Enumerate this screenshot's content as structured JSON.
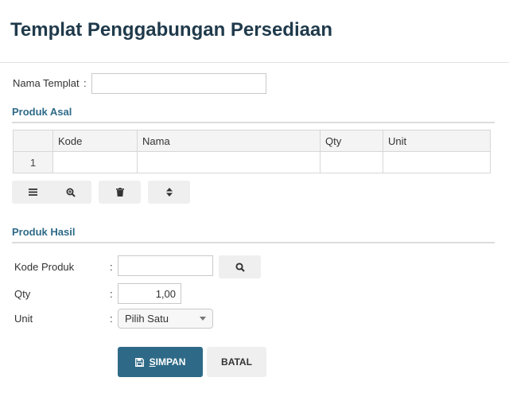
{
  "page": {
    "title": "Templat Penggabungan Persediaan"
  },
  "form": {
    "nama_templat": {
      "label": "Nama Templat",
      "colon": ":",
      "value": "",
      "placeholder": ""
    }
  },
  "produk_asal": {
    "title": "Produk Asal",
    "columns": [
      "",
      "Kode",
      "Nama",
      "Qty",
      "Unit"
    ],
    "rows": [
      {
        "no": "1",
        "kode": "",
        "nama": "",
        "qty": "",
        "unit": ""
      }
    ],
    "toolbar": [
      "list-icon",
      "zoom-icon",
      "trash-icon",
      "sort-icon"
    ]
  },
  "produk_hasil": {
    "title": "Produk Hasil",
    "kode_produk": {
      "label": "Kode Produk",
      "colon": ":",
      "value": ""
    },
    "qty": {
      "label": "Qty",
      "colon": ":",
      "value": "1,00"
    },
    "unit": {
      "label": "Unit",
      "colon": ":",
      "selected": "Pilih Satu"
    }
  },
  "actions": {
    "save_label_first": "S",
    "save_label_rest": "IMPAN",
    "cancel_label": "BATAL"
  },
  "colors": {
    "primary": "#2e6a87",
    "title": "#1f3a4b",
    "button_bg": "#efefef"
  }
}
